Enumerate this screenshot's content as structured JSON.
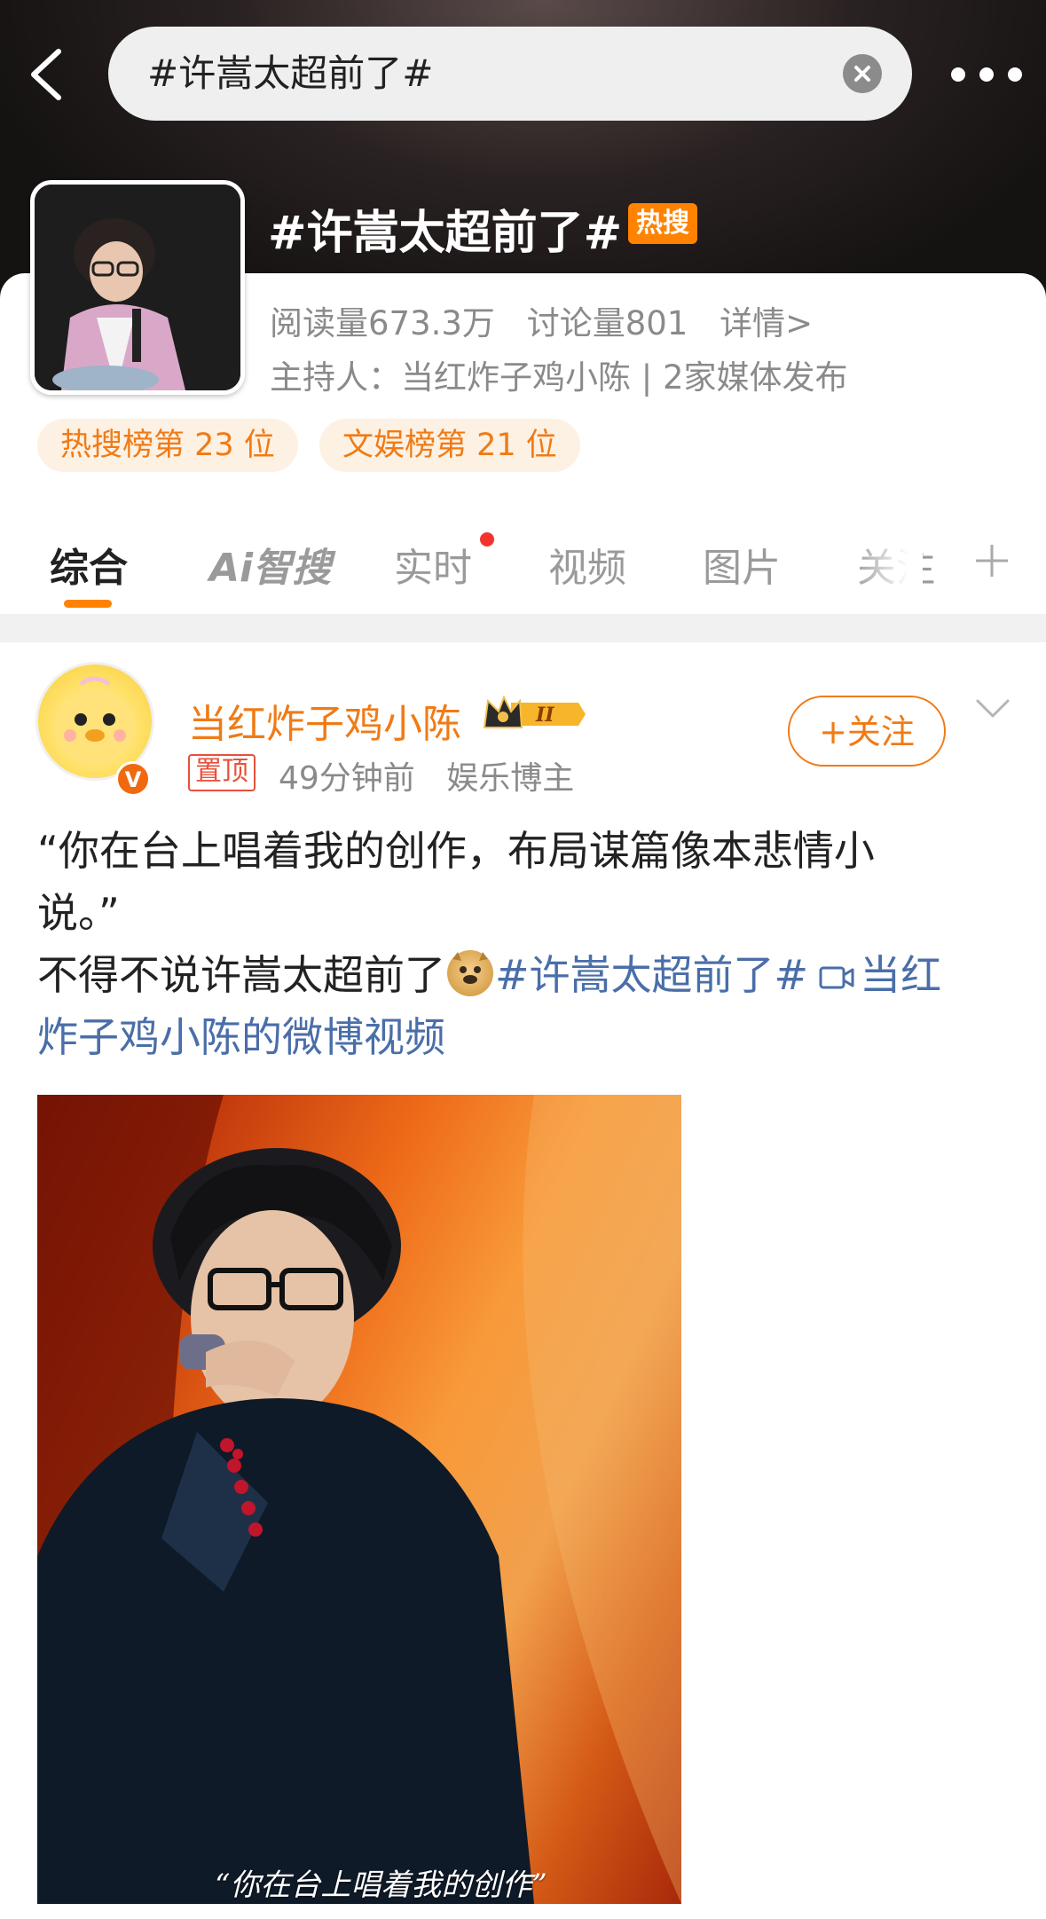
{
  "search": {
    "query": "#许嵩太超前了#"
  },
  "topic": {
    "title": "#许嵩太超前了#",
    "hot_badge": "热搜",
    "stats": {
      "reads": "阅读量673.3万",
      "discussions": "讨论量801",
      "details": "详情>"
    },
    "host": "主持人：当红炸子鸡小陈 | 2家媒体发布",
    "ranks": [
      "热搜榜第 23 位",
      "文娱榜第 21 位"
    ]
  },
  "tabs": [
    {
      "label": "综合",
      "active": true
    },
    {
      "label": "Ai智搜"
    },
    {
      "label": "实时",
      "has_dot": true
    },
    {
      "label": "视频"
    },
    {
      "label": "图片"
    },
    {
      "label": "关注"
    }
  ],
  "post": {
    "author": "当红炸子鸡小陈",
    "pinned_label": "置顶",
    "time": "49分钟前",
    "category": "娱乐博主",
    "follow_label": "+关注",
    "text_line1": "“你在台上唱着我的创作，布局谋篇像本悲情小",
    "text_line2": "说。”",
    "text_line3_prefix": "不得不说许嵩太超前了",
    "hashtag": "#许嵩太超前了#",
    "video_link_part1": "当红",
    "video_link_part2": "炸子鸡小陈的微博视频",
    "media_caption": "“你在台上唱着我的创作”"
  },
  "colors": {
    "accent": "#ff8200",
    "link": "#4a6ea8",
    "hot": "#ff8200"
  }
}
